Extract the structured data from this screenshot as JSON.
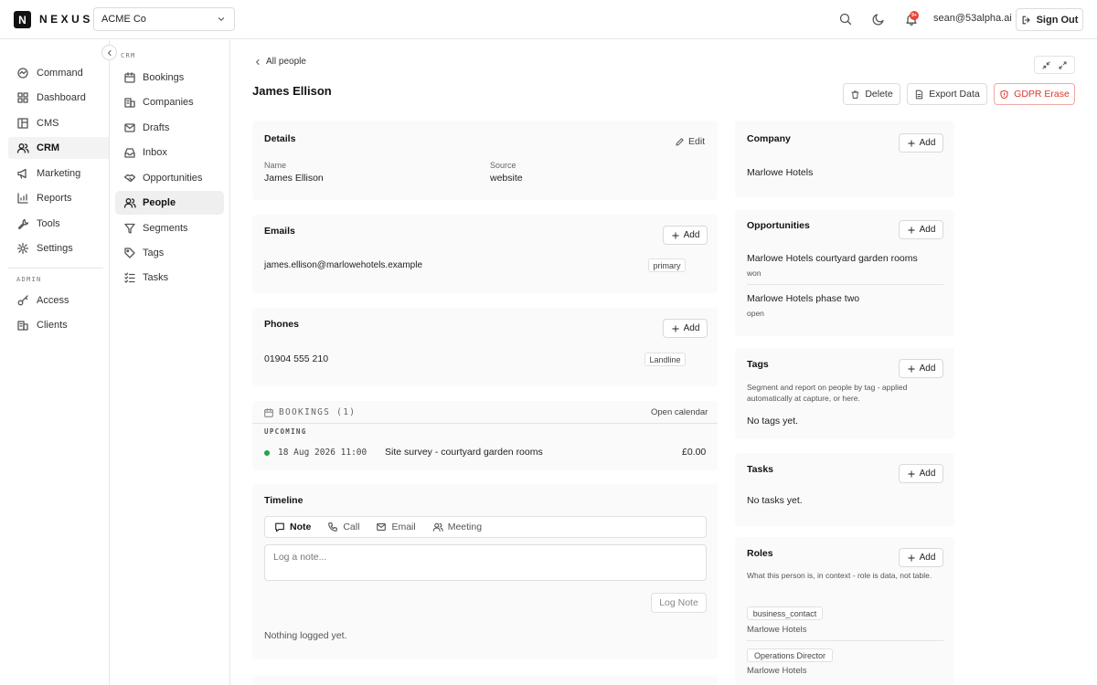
{
  "brand": {
    "logo_letter": "N",
    "name": "NEXUS"
  },
  "org_select": {
    "value": "ACME Co"
  },
  "header": {
    "notif_badge": "9+",
    "user_email": "sean@53alpha.ai",
    "sign_out_label": "Sign Out"
  },
  "sidebar": {
    "items": [
      {
        "label": "Command",
        "icon": "command-icon"
      },
      {
        "label": "Dashboard",
        "icon": "dashboard-icon"
      },
      {
        "label": "CMS",
        "icon": "cms-icon"
      },
      {
        "label": "CRM",
        "icon": "crm-icon",
        "active": true
      },
      {
        "label": "Marketing",
        "icon": "megaphone-icon"
      },
      {
        "label": "Reports",
        "icon": "chart-icon"
      },
      {
        "label": "Tools",
        "icon": "wrench-icon"
      },
      {
        "label": "Settings",
        "icon": "gear-icon"
      }
    ],
    "admin_label": "ADMIN",
    "admin_items": [
      {
        "label": "Access",
        "icon": "key-icon"
      },
      {
        "label": "Clients",
        "icon": "building-icon"
      }
    ]
  },
  "crm_nav": {
    "section_label": "CRM",
    "items": [
      {
        "label": "Bookings",
        "icon": "calendar-icon"
      },
      {
        "label": "Companies",
        "icon": "building-icon"
      },
      {
        "label": "Drafts",
        "icon": "mail-icon"
      },
      {
        "label": "Inbox",
        "icon": "inbox-icon"
      },
      {
        "label": "Opportunities",
        "icon": "handshake-icon"
      },
      {
        "label": "People",
        "icon": "people-icon",
        "active": true
      },
      {
        "label": "Segments",
        "icon": "filter-icon"
      },
      {
        "label": "Tags",
        "icon": "tag-icon"
      },
      {
        "label": "Tasks",
        "icon": "tasks-icon"
      }
    ]
  },
  "main": {
    "back_label": "All people",
    "title": "James Ellison",
    "actions": {
      "delete": "Delete",
      "export": "Export Data",
      "gdpr": "GDPR Erase"
    },
    "details": {
      "title": "Details",
      "edit_label": "Edit",
      "name_label": "Name",
      "name_value": "James Ellison",
      "source_label": "Source",
      "source_value": "website"
    },
    "emails": {
      "title": "Emails",
      "add_label": "Add",
      "address": "james.ellison@marlowehotels.example",
      "badge": "primary"
    },
    "phones": {
      "title": "Phones",
      "add_label": "Add",
      "number": "01904 555 210",
      "badge": "Landline"
    },
    "bookings": {
      "title": "BOOKINGS (1)",
      "open_calendar": "Open calendar",
      "upcoming_label": "UPCOMING",
      "item": {
        "datetime": "18 Aug 2026 11:00",
        "name": "Site survey - courtyard garden rooms",
        "amount": "£0.00",
        "status_color": "#22a34a"
      }
    },
    "timeline": {
      "title": "Timeline",
      "tabs": [
        {
          "label": "Note",
          "icon": "note-icon",
          "active": true
        },
        {
          "label": "Call",
          "icon": "phone-icon"
        },
        {
          "label": "Email",
          "icon": "mail-icon"
        },
        {
          "label": "Meeting",
          "icon": "people-icon"
        }
      ],
      "placeholder": "Log a note...",
      "log_button": "Log Note",
      "empty": "Nothing logged yet."
    }
  },
  "right": {
    "company": {
      "title": "Company",
      "add_label": "Add",
      "value": "Marlowe Hotels"
    },
    "opportunities": {
      "title": "Opportunities",
      "add_label": "Add",
      "items": [
        {
          "name": "Marlowe Hotels courtyard garden rooms",
          "status": "won"
        },
        {
          "name": "Marlowe Hotels phase two",
          "status": "open"
        }
      ]
    },
    "tags": {
      "title": "Tags",
      "add_label": "Add",
      "description": "Segment and report on people by tag - applied automatically at capture, or here.",
      "empty": "No tags yet."
    },
    "tasks": {
      "title": "Tasks",
      "add_label": "Add",
      "empty": "No tasks yet."
    },
    "roles": {
      "title": "Roles",
      "add_label": "Add",
      "description": "What this person is, in context - role is data, not table.",
      "items": [
        {
          "role": "business_contact",
          "company": "Marlowe Hotels"
        },
        {
          "role": "Operations Director",
          "company": "Marlowe Hotels"
        }
      ]
    }
  },
  "colors": {
    "danger": "#d93a2f",
    "success": "#22a34a",
    "badge": "#e8443a"
  }
}
